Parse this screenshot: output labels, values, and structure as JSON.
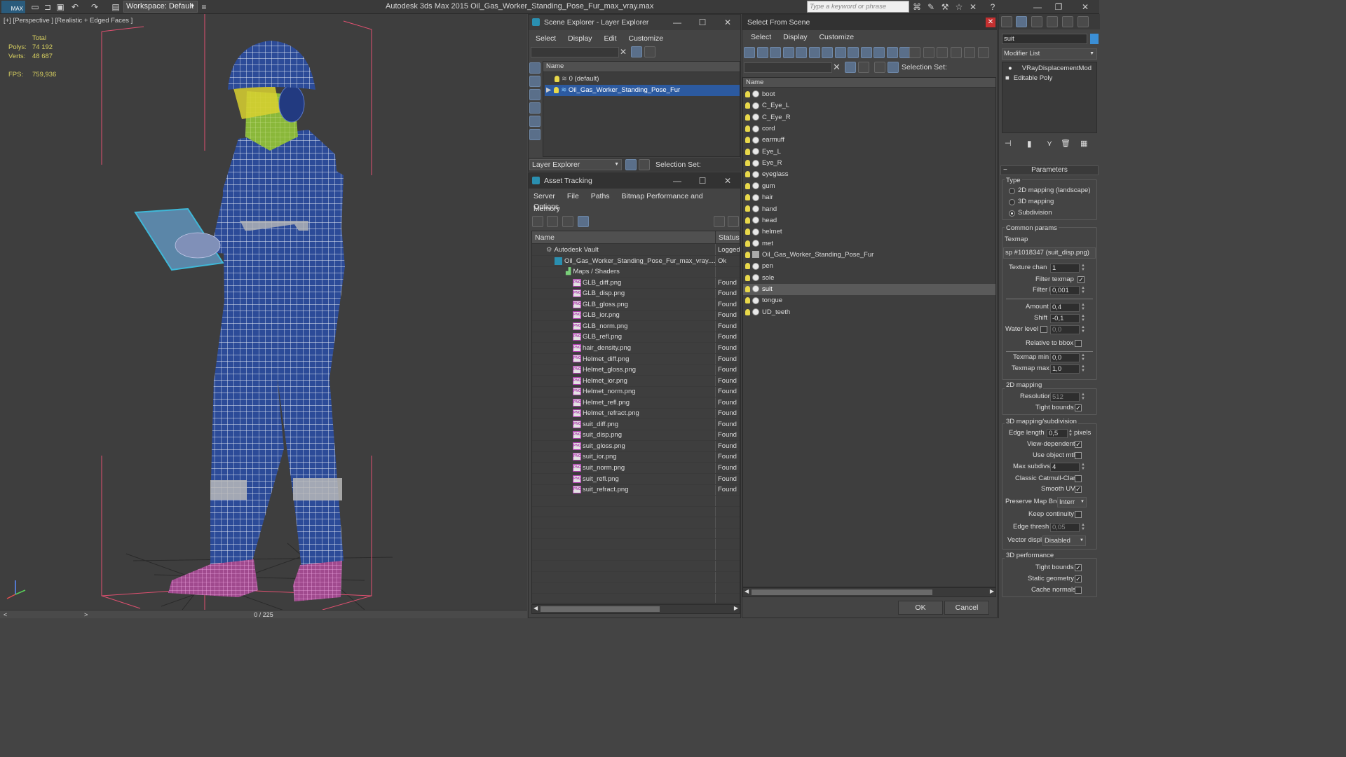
{
  "titlebar": {
    "logo": "MAX",
    "workspace": "Workspace: Default",
    "app_title": "Autodesk 3ds Max  2015    Oil_Gas_Worker_Standing_Pose_Fur_max_vray.max",
    "search_placeholder": "Type a keyword or phrase"
  },
  "viewport": {
    "label": "[+] [Perspective ] [Realistic + Edged Faces ]",
    "total_label": "Total",
    "polys_label": "Polys:",
    "polys_value": "74 192",
    "verts_label": "Verts:",
    "verts_value": "48 687",
    "fps_label": "FPS:",
    "fps_value": "759,936"
  },
  "timeline": {
    "frame": "0 / 225",
    "prev": "<",
    "next": ">"
  },
  "scene_explorer": {
    "title": "Scene Explorer - Layer Explorer",
    "menu": [
      "Select",
      "Display",
      "Edit",
      "Customize"
    ],
    "column_name": "Name",
    "rows": [
      "0 (default)",
      "Oil_Gas_Worker_Standing_Pose_Fur"
    ],
    "footer_dropdown": "Layer Explorer",
    "selection_set_label": "Selection Set:"
  },
  "asset_tracking": {
    "title": "Asset Tracking",
    "menu_line1": [
      "Server",
      "File",
      "Paths",
      "Bitmap Performance and Memory"
    ],
    "menu_line2": [
      "Options"
    ],
    "col_name": "Name",
    "col_status": "Status",
    "vault_name": "Autodesk Vault",
    "vault_status": "Logged",
    "file_name": "Oil_Gas_Worker_Standing_Pose_Fur_max_vray....",
    "file_status": "Ok",
    "maps_name": "Maps / Shaders",
    "maps_status": "",
    "files": [
      {
        "name": "GLB_diff.png",
        "status": "Found"
      },
      {
        "name": "GLB_disp.png",
        "status": "Found"
      },
      {
        "name": "GLB_gloss.png",
        "status": "Found"
      },
      {
        "name": "GLB_ior.png",
        "status": "Found"
      },
      {
        "name": "GLB_norm.png",
        "status": "Found"
      },
      {
        "name": "GLB_refl.png",
        "status": "Found"
      },
      {
        "name": "hair_density.png",
        "status": "Found"
      },
      {
        "name": "Helmet_diff.png",
        "status": "Found"
      },
      {
        "name": "Helmet_gloss.png",
        "status": "Found"
      },
      {
        "name": "Helmet_ior.png",
        "status": "Found"
      },
      {
        "name": "Helmet_norm.png",
        "status": "Found"
      },
      {
        "name": "Helmet_refl.png",
        "status": "Found"
      },
      {
        "name": "Helmet_refract.png",
        "status": "Found"
      },
      {
        "name": "suit_diff.png",
        "status": "Found"
      },
      {
        "name": "suit_disp.png",
        "status": "Found"
      },
      {
        "name": "suit_gloss.png",
        "status": "Found"
      },
      {
        "name": "suit_ior.png",
        "status": "Found"
      },
      {
        "name": "suit_norm.png",
        "status": "Found"
      },
      {
        "name": "suit_refl.png",
        "status": "Found"
      },
      {
        "name": "suit_refract.png",
        "status": "Found"
      }
    ]
  },
  "select_from_scene": {
    "title": "Select From Scene",
    "menu": [
      "Select",
      "Display",
      "Customize"
    ],
    "selection_set_label": "Selection Set:",
    "column_name": "Name",
    "objects": [
      "boot",
      "C_Eye_L",
      "C_Eye_R",
      "cord",
      "earmuff",
      "Eye_L",
      "Eye_R",
      "eyeglass",
      "gum",
      "hair",
      "hand",
      "head",
      "helmet",
      "met",
      "Oil_Gas_Worker_Standing_Pose_Fur",
      "pen",
      "sole",
      "suit",
      "tongue",
      "UD_teeth"
    ],
    "selected": "suit",
    "ok": "OK",
    "cancel": "Cancel"
  },
  "command_panel": {
    "object_name": "suit",
    "modifier_list": "Modifier List",
    "stack": [
      "VRayDisplacementMod",
      "Editable Poly"
    ],
    "rollout": "Parameters",
    "type_label": "Type",
    "type_options": [
      "2D mapping (landscape)",
      "3D mapping",
      "Subdivision"
    ],
    "type_selected": 2,
    "common_label": "Common params",
    "texmap_label": "Texmap",
    "texmap_value": "sp #1018347 (suit_disp.png)",
    "texture_chan_label": "Texture chan",
    "texture_chan_value": "1",
    "filter_texmap_label": "Filter texmap",
    "filter_blur_label": "Filter blur",
    "filter_blur_value": "0,001",
    "amount_label": "Amount",
    "amount_value": "0,4",
    "shift_label": "Shift",
    "shift_value": "-0,1",
    "water_level_label": "Water level",
    "water_level_value": "0,0",
    "relative_bbox_label": "Relative to bbox",
    "texmap_min_label": "Texmap min",
    "texmap_min_value": "0,0",
    "texmap_max_label": "Texmap max",
    "texmap_max_value": "1,0",
    "mapping2d_label": "2D mapping",
    "resolution_label": "Resolution",
    "resolution_value": "512",
    "tight_bounds_label": "Tight bounds",
    "mapping3d_label": "3D mapping/subdivision",
    "edge_length_label": "Edge length",
    "edge_length_value": "0,5",
    "pixels_label": "pixels",
    "view_dependent_label": "View-dependent",
    "use_object_mtl_label": "Use object mtl",
    "max_subdivs_label": "Max subdivs",
    "max_subdivs_value": "4",
    "catmull_label": "Classic Catmull-Clark",
    "smooth_uvs_label": "Smooth UVs",
    "preserve_label": "Preserve Map Bnd",
    "preserve_value": "Interr",
    "keep_continuity_label": "Keep continuity",
    "edge_thresh_label": "Edge thresh",
    "edge_thresh_value": "0,05",
    "vector_displ_label": "Vector displ",
    "vector_displ_value": "Disabled",
    "perf_label": "3D performance",
    "perf_tight_label": "Tight bounds",
    "static_geo_label": "Static geometry",
    "cache_normals_label": "Cache normals",
    "check": "✓"
  },
  "colors": {
    "wireframe_suit": "#2a4a9a",
    "wire_lines": "#ffffff",
    "selection_blue": "#2c5aa0",
    "stats_yellow": "#d8d060",
    "boots_pink": "#e88ad0"
  }
}
